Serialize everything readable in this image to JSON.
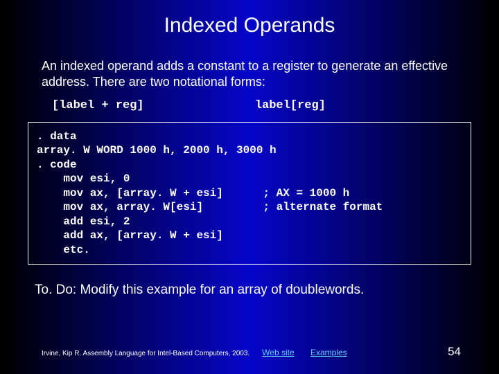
{
  "title": "Indexed Operands",
  "body": "An indexed operand adds a constant to a register to generate an effective address. There are two notational forms:",
  "form1": "[label + reg]",
  "form2": "label[reg]",
  "code": ". data\narray. W WORD 1000 h, 2000 h, 3000 h\n. code\n    mov esi, 0\n    mov ax, [array. W + esi]      ; AX = 1000 h\n    mov ax, array. W[esi]         ; alternate format\n    add esi, 2\n    add ax, [array. W + esi]\n    etc.",
  "todo": "To. Do: Modify this example for an array of doublewords.",
  "footer": {
    "citation": "Irvine, Kip R. Assembly Language for Intel-Based Computers, 2003.",
    "link1": "Web site",
    "link2": "Examples",
    "page": "54"
  }
}
